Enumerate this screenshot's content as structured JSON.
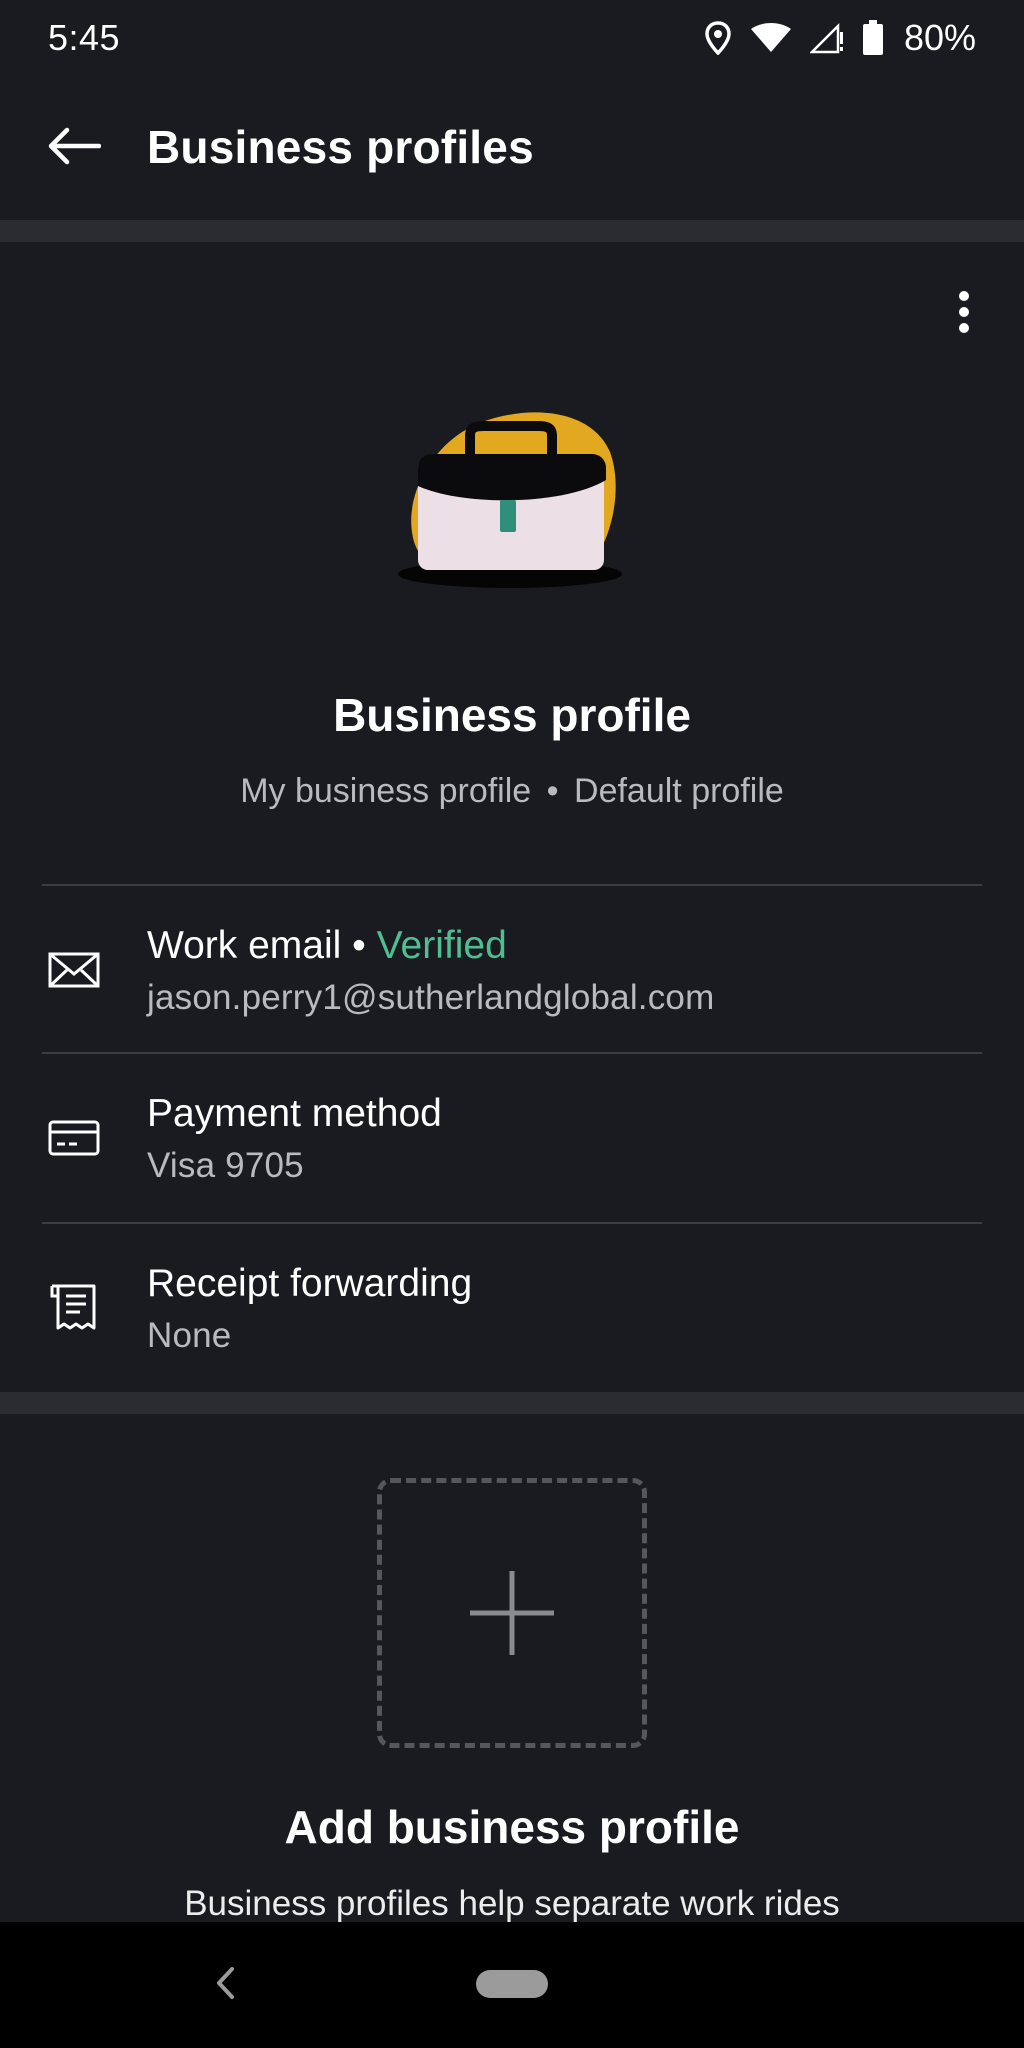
{
  "status_bar": {
    "time": "5:45",
    "battery_percent": "80%",
    "icons": [
      "location-icon",
      "wifi-icon",
      "signal-icon",
      "battery-icon"
    ]
  },
  "app_bar": {
    "title": "Business profiles",
    "back_icon": "arrow-left-icon"
  },
  "profile": {
    "title": "Business profile",
    "subtitle_name": "My business profile",
    "subtitle_separator": "•",
    "subtitle_default": "Default profile",
    "illustration": "briefcase-illustration",
    "menu_icon": "more-vertical-icon",
    "rows": [
      {
        "icon": "envelope-icon",
        "title": "Work email",
        "separator": "•",
        "status": "Verified",
        "subtitle": "jason.perry1@sutherlandglobal.com"
      },
      {
        "icon": "credit-card-icon",
        "title": "Payment method",
        "subtitle": "Visa 9705"
      },
      {
        "icon": "receipt-icon",
        "title": "Receipt forwarding",
        "subtitle": "None"
      }
    ]
  },
  "add_profile": {
    "icon": "plus-icon",
    "title": "Add business profile",
    "description": "Business profiles help separate work rides"
  },
  "nav_bar": {
    "back_icon": "chevron-left-icon",
    "home_icon": "home-pill-icon"
  },
  "colors": {
    "background": "#1a1b20",
    "divider": "#2a2c31",
    "verified": "#4fbf93",
    "briefcase_accent": "#e2a820"
  }
}
